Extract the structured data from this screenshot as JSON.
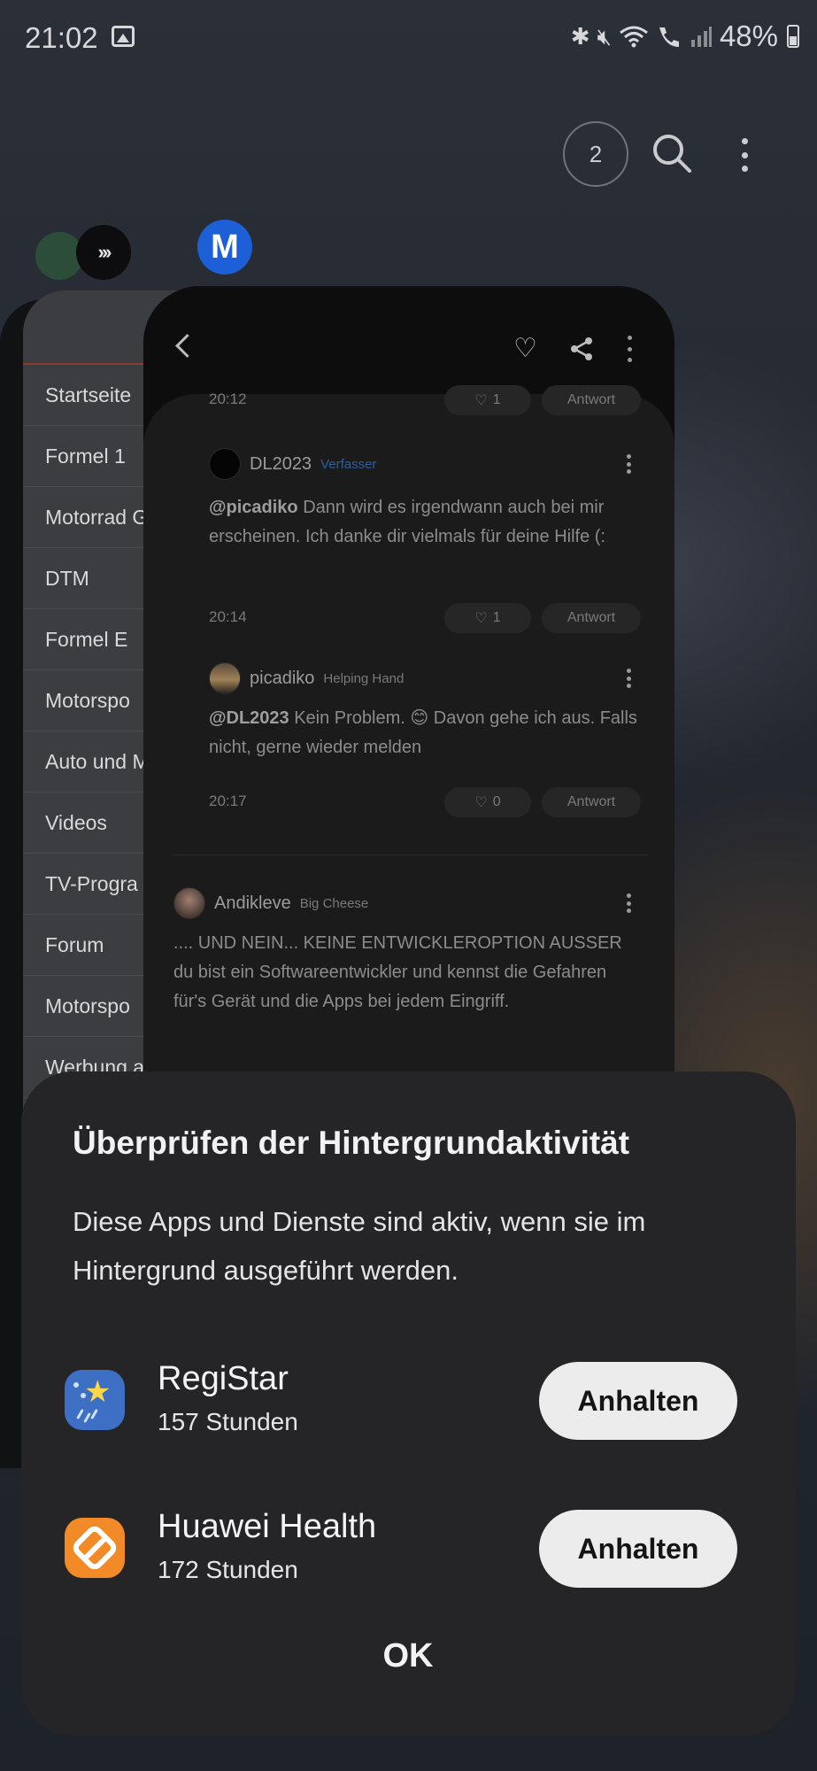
{
  "status_bar": {
    "time": "21:02",
    "battery": "48%",
    "icons": [
      "gallery-icon",
      "bluetooth-icon",
      "mute-icon",
      "wifi-icon",
      "wifi-call-icon",
      "signal-icon",
      "battery-icon"
    ]
  },
  "recents": {
    "window_count": "2",
    "icons": [
      "search-icon",
      "more-options-icon"
    ]
  },
  "left_app_menu": {
    "items": [
      "Startseite",
      "Formel 1",
      "Motorrad G",
      "DTM",
      "Formel E",
      "Motorspo",
      "Auto und M",
      "Videos",
      "TV-Progra",
      "Forum",
      "Motorspo",
      "Werbung a"
    ]
  },
  "forum_card": {
    "icons": [
      "back-icon",
      "heart-icon",
      "share-icon",
      "more-icon"
    ],
    "top_meta": {
      "time": "20:12",
      "likes": "1",
      "reply": "Antwort"
    },
    "comments": [
      {
        "author": "DL2023",
        "role": "Verfasser",
        "mention": "@picadiko",
        "text": " Dann wird es irgendwann auch bei mir erscheinen. Ich danke dir vielmals für deine Hilfe (:",
        "time": "20:14",
        "likes": "1",
        "reply": "Antwort"
      },
      {
        "author": "picadiko",
        "role": "Helping Hand",
        "mention": "@DL2023",
        "text": " Kein Problem. 😊 Davon gehe ich aus. Falls nicht, gerne wieder melden",
        "time": "20:17",
        "likes": "0",
        "reply": "Antwort"
      },
      {
        "author": "Andikleve",
        "role": "Big Cheese",
        "text": ".... UND NEIN... KEINE ENTWICKLEROPTION AUSSER du bist ein Softwareentwickler und kennst die Gefahren für's Gerät und die Apps bei jedem Eingriff."
      }
    ]
  },
  "dialog": {
    "title": "Überprüfen der Hintergrundaktivität",
    "description": "Diese Apps und Dienste sind aktiv, wenn sie im Hintergrund ausgeführt werden.",
    "apps": [
      {
        "name": "RegiStar",
        "hours": "157 Stunden",
        "button": "Anhalten",
        "icon": "registar-app-icon"
      },
      {
        "name": "Huawei Health",
        "hours": "172 Stunden",
        "button": "Anhalten",
        "icon": "huawei-health-app-icon"
      }
    ],
    "ok_label": "OK"
  }
}
